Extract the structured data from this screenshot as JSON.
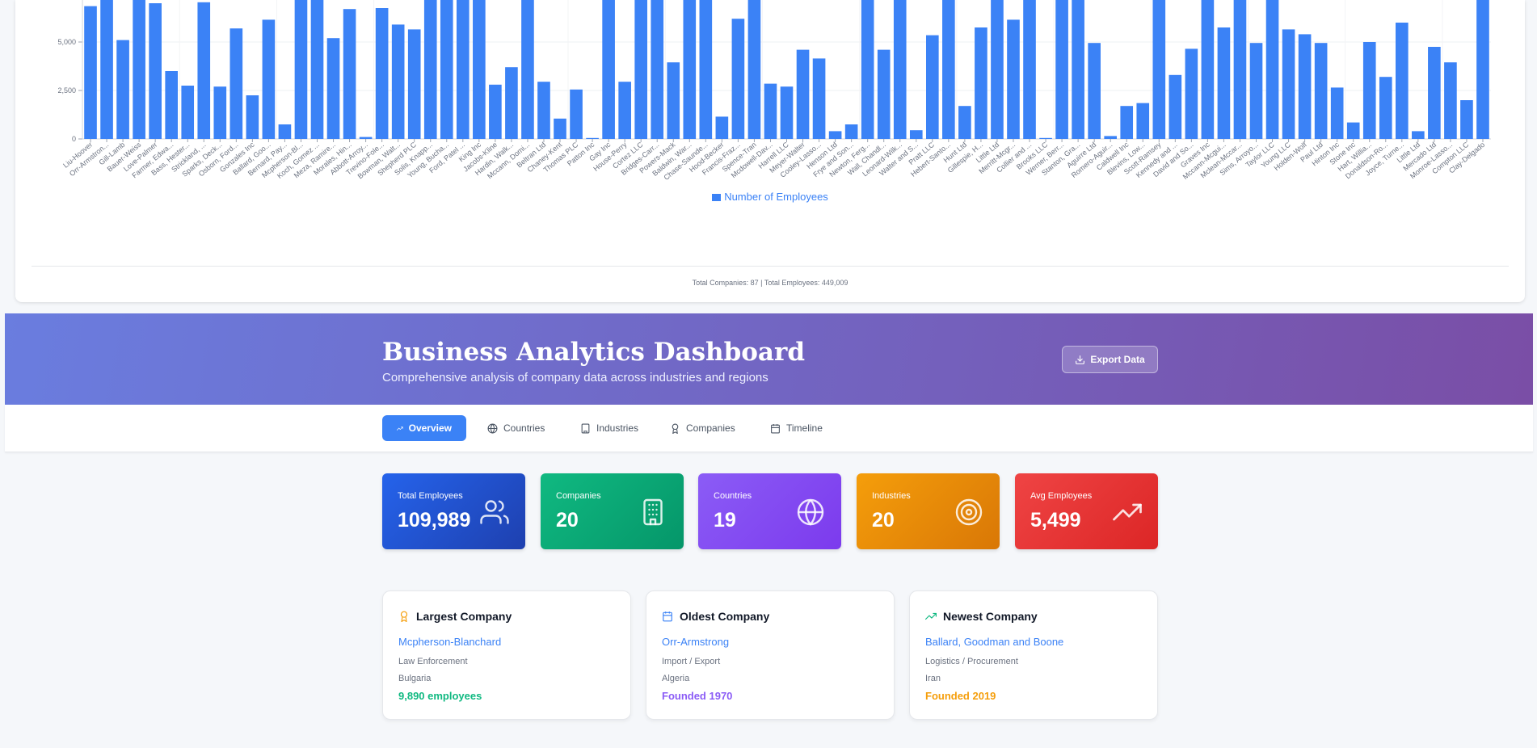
{
  "chart_data": {
    "type": "bar",
    "categories": [
      "Liu-Hoover",
      "Orr-Armstron...",
      "Gill-Lamb",
      "Bauer-Weiss",
      "Love-Palmer",
      "Farmer, Edwa...",
      "Bass, Hester...",
      "Strickland, ...",
      "Sparks, Deck...",
      "Osborn, Ford...",
      "Gonzales Inc",
      "Ballard, Goo...",
      "Bernard, Pay...",
      "Mcpherson-Bl...",
      "Koch, Gomez ...",
      "Meza, Ramire...",
      "Morales, Hin...",
      "Abbott-Arroy...",
      "Trevino-Fole...",
      "Bowman, Walt...",
      "Shepherd PLC",
      "Solis, Knapp...",
      "Young, Bucha...",
      "Ford, Patel ...",
      "King Inc",
      "Jacobs-Kline",
      "Hardin, Walk...",
      "Mccann, Domi...",
      "Beltran Ltd",
      "Chaney-Kent",
      "Thomas PLC",
      "Patton Inc",
      "Gay Inc",
      "House-Perry",
      "Cortez LLC",
      "Bridges-Carr...",
      "Powers-Mack",
      "Baldwin, War...",
      "Chase-Saunde...",
      "Hood-Becker",
      "Francis-Fraz...",
      "Spence-Tran",
      "Mcdowell-Dav...",
      "Harrell LLC",
      "Meyer-Walter",
      "Cooley-Lasso...",
      "Henson Ltd",
      "Frye and Son...",
      "Newton, Ferg...",
      "Wall, Chandl...",
      "Leonard-Wilk...",
      "Walter and S...",
      "Pratt LLC",
      "Hebert-Santo...",
      "Hunt Ltd",
      "Gillespie, H...",
      "Little Ltd",
      "Merritt-Mcgr...",
      "Collier and ...",
      "Brooks LLC",
      "Werner, Berr...",
      "Stanton, Gra...",
      "Aguirre Ltd",
      "Romero-Aguir...",
      "Caldwell Inc",
      "Blevins, Low...",
      "Scott-Ramsey",
      "Kennedy and ...",
      "David and So...",
      "Graves Inc",
      "Mccann-Mcgui...",
      "Mclean-Mccar...",
      "Sims, Arroyo...",
      "Taylor LLC",
      "Young LLC",
      "Holden-Wolf",
      "Paul Ltd",
      "Hinton Inc",
      "Stone Inc",
      "Hart, Willia...",
      "Donaldson-Ro...",
      "Joyce, Turne...",
      "Little Ltd",
      "Mercado Ltd",
      "Monroe-Lasso...",
      "Compton LLC",
      "Clay-Delgado"
    ],
    "values": [
      6850,
      7600,
      5100,
      7600,
      7000,
      3500,
      2750,
      7050,
      2700,
      5700,
      2250,
      6150,
      750,
      7600,
      7600,
      5200,
      6700,
      100,
      6750,
      5900,
      5650,
      7600,
      7600,
      7600,
      7600,
      2800,
      3700,
      7600,
      2950,
      1050,
      2550,
      50,
      7600,
      2950,
      7600,
      7600,
      3950,
      7600,
      7600,
      1150,
      6200,
      7600,
      2850,
      2700,
      4600,
      4150,
      400,
      750,
      7600,
      4600,
      7600,
      450,
      5350,
      7600,
      1700,
      5750,
      7600,
      6150,
      7600,
      50,
      7600,
      7600,
      4950,
      150,
      1700,
      1850,
      7600,
      3300,
      4650,
      7600,
      5750,
      7600,
      4950,
      7600,
      5650,
      5400,
      4950,
      2650,
      850,
      5000,
      3200,
      6000,
      400,
      4750,
      3950,
      2000,
      7600
    ],
    "yticks": [
      0,
      2500,
      5000
    ],
    "ytick_labels": [
      "0",
      "2,500",
      "5,000"
    ],
    "series": [
      {
        "name": "Number of Employees"
      }
    ],
    "legend": "bottom",
    "grid": true
  },
  "chart_footer": "Total Companies: 87 | Total Employees: 449,009",
  "header": {
    "title": "Business Analytics Dashboard",
    "subtitle": "Comprehensive analysis of company data across industries and regions",
    "export_label": "Export Data"
  },
  "tabs": [
    {
      "label": "Overview",
      "icon": "trending-up-icon",
      "active": true
    },
    {
      "label": "Countries",
      "icon": "globe-icon"
    },
    {
      "label": "Industries",
      "icon": "building-icon"
    },
    {
      "label": "Companies",
      "icon": "award-icon"
    },
    {
      "label": "Timeline",
      "icon": "calendar-icon"
    }
  ],
  "stats": [
    {
      "label": "Total Employees",
      "value": "109,989",
      "icon": "users-icon",
      "color": "#2563eb"
    },
    {
      "label": "Companies",
      "value": "20",
      "icon": "building-icon",
      "color": "#10b981"
    },
    {
      "label": "Countries",
      "value": "19",
      "icon": "globe-icon",
      "color": "#8b5cf6"
    },
    {
      "label": "Industries",
      "value": "20",
      "icon": "target-icon",
      "color": "#f59e0b"
    },
    {
      "label": "Avg Employees",
      "value": "5,499",
      "icon": "trending-up-icon",
      "color": "#ef4444"
    }
  ],
  "highlights": {
    "largest": {
      "title": "Largest Company",
      "name": "Mcpherson-Blanchard",
      "industry": "Law Enforcement",
      "country": "Bulgaria",
      "highlight": "9,890 employees",
      "color": "#10b981"
    },
    "oldest": {
      "title": "Oldest Company",
      "name": "Orr-Armstrong",
      "industry": "Import / Export",
      "country": "Algeria",
      "highlight": "Founded 1970",
      "color": "#8b5cf6"
    },
    "newest": {
      "title": "Newest Company",
      "name": "Ballard, Goodman and Boone",
      "industry": "Logistics / Procurement",
      "country": "Iran",
      "highlight": "Founded 2019",
      "color": "#f59e0b"
    }
  }
}
